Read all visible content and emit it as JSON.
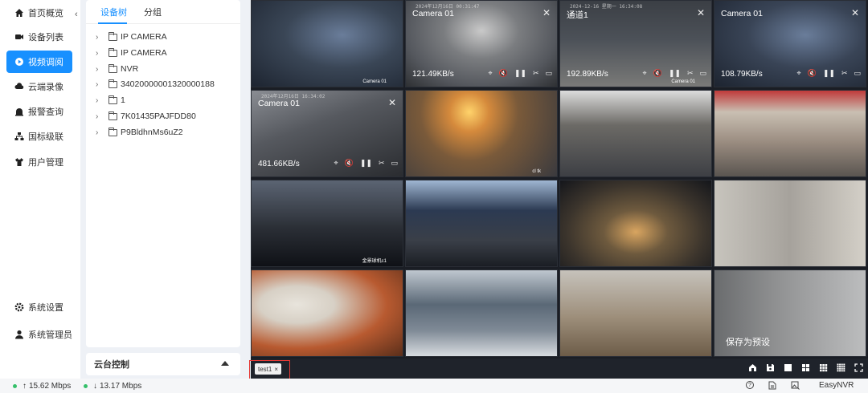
{
  "sidebar": {
    "items": [
      {
        "label": "首页概览",
        "icon": "home-icon",
        "active": false
      },
      {
        "label": "设备列表",
        "icon": "camera-icon",
        "active": false
      },
      {
        "label": "视频调阅",
        "icon": "play-icon",
        "active": true
      },
      {
        "label": "云端录像",
        "icon": "cloud-icon",
        "active": false
      },
      {
        "label": "报警查询",
        "icon": "alarm-icon",
        "active": false
      },
      {
        "label": "国标级联",
        "icon": "cascade-icon",
        "active": false
      },
      {
        "label": "用户管理",
        "icon": "user-shirt-icon",
        "active": false
      }
    ],
    "bottom_items": [
      {
        "label": "系统设置",
        "icon": "gear-icon"
      },
      {
        "label": "系统管理员",
        "icon": "person-icon"
      }
    ]
  },
  "tree": {
    "tabs": [
      {
        "label": "设备树",
        "active": true
      },
      {
        "label": "分组",
        "active": false
      }
    ],
    "nodes": [
      "IP CAMERA",
      "IP CAMERA",
      "NVR",
      "34020000001320000188",
      "1",
      "7K01435PAJFDD80",
      "P9BldhnMs6uZ2"
    ]
  },
  "ptz": {
    "label": "云台控制"
  },
  "grid": {
    "cells": [
      {
        "name": "",
        "rate": "",
        "tag": "Camera 01",
        "ts": "",
        "bg": "#3a4656",
        "scene": "dark-cables"
      },
      {
        "name": "Camera 01",
        "rate": "121.49KB/s",
        "tag": "",
        "ts": "2024年12月16日  00:31:47",
        "bg": "#55585e",
        "scene": "gray-cables"
      },
      {
        "name": "通道1",
        "rate": "192.89KB/s",
        "tag": "Camera 01",
        "ts": "2024-12-16  星期一  16:34:08",
        "bg": "#4c5158",
        "scene": "room"
      },
      {
        "name": "Camera 01",
        "rate": "108.79KB/s",
        "tag": "",
        "ts": "",
        "bg": "#394456",
        "scene": "dark-cables"
      },
      {
        "name": "Camera 01",
        "rate": "481.66KB/s",
        "tag": "",
        "ts": "2024年12月16日  16:34:02",
        "bg": "#56595f",
        "scene": "device"
      },
      {
        "name": "",
        "rate": "",
        "tag": "cl tk",
        "ts": "",
        "bg": "#7a5a3a",
        "scene": "sunset"
      },
      {
        "name": "",
        "rate": "",
        "tag": "",
        "ts": "",
        "bg": "#6c6a66",
        "scene": "rack"
      },
      {
        "name": "",
        "rate": "",
        "tag": "",
        "ts": "",
        "bg": "#9a8c80",
        "scene": "warehouse"
      },
      {
        "name": "",
        "rate": "",
        "tag": "金景球机c1",
        "ts": "",
        "bg": "#2b2f36",
        "scene": "city-night"
      },
      {
        "name": "",
        "rate": "",
        "tag": "",
        "ts": "",
        "bg": "#3a3f48",
        "scene": "control-room"
      },
      {
        "name": "",
        "rate": "",
        "tag": "",
        "ts": "",
        "bg": "#3b342c",
        "scene": "aerial-night"
      },
      {
        "name": "",
        "rate": "",
        "tag": "",
        "ts": "",
        "bg": "#a6a29c",
        "scene": "corridor"
      },
      {
        "name": "",
        "rate": "",
        "tag": "",
        "ts": "",
        "bg": "#b85a30",
        "scene": "hand"
      },
      {
        "name": "",
        "rate": "",
        "tag": "",
        "ts": "",
        "bg": "#7f8a96",
        "scene": "office"
      },
      {
        "name": "",
        "rate": "",
        "tag": "",
        "ts": "",
        "bg": "#9d8e7a",
        "scene": "workshop"
      },
      {
        "name": "",
        "rate": "",
        "tag": "",
        "ts": "",
        "bg": "#8f9091",
        "scene": "hallway"
      }
    ],
    "preset_label": "保存为预设"
  },
  "toolbar": {
    "chip_label": "test1",
    "icons": [
      "home-layout-icon",
      "save-icon",
      "layout-1-icon",
      "layout-4-icon",
      "layout-9-icon",
      "layout-16-icon",
      "fullscreen-icon"
    ]
  },
  "status": {
    "upload": "15.62 Mbps",
    "download": "13.17 Mbps",
    "brand": "EasyNVR"
  },
  "colors": {
    "accent": "#1890ff",
    "highlight": "#e53935",
    "status_ok": "#35c06a"
  }
}
